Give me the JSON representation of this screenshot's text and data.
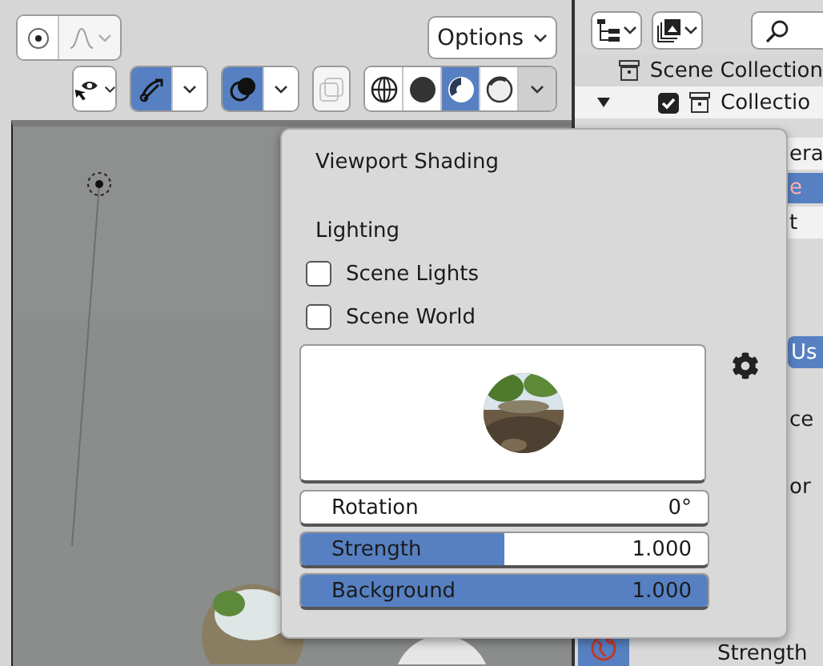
{
  "viewport_header": {
    "snap_toggles": [
      {
        "kind": "pivot",
        "disabled": false
      },
      {
        "kind": "falloff",
        "disabled": true
      }
    ],
    "options": {
      "label": "Options"
    },
    "toggles": [
      {
        "kind": "visibility",
        "selected": false,
        "disabled": false
      },
      {
        "kind": "gizmo",
        "selected": true,
        "disabled": false
      },
      {
        "kind": "overlay",
        "selected": true,
        "disabled": false
      },
      {
        "kind": "xray",
        "selected": false,
        "disabled": true
      }
    ],
    "shading_modes": [
      {
        "kind": "wireframe",
        "selected": false
      },
      {
        "kind": "solid",
        "selected": false
      },
      {
        "kind": "material",
        "selected": true
      },
      {
        "kind": "rendered",
        "selected": false
      }
    ]
  },
  "outliner": {
    "items": [
      {
        "label": "Scene Collection",
        "kind": "scene",
        "selected": false
      },
      {
        "label": "Collectio",
        "kind": "collection",
        "selected": false,
        "checked": true,
        "expanded": true
      },
      {
        "label": "era",
        "kind": "object",
        "selected": false
      },
      {
        "label": "e",
        "kind": "object",
        "selected": true
      },
      {
        "label": "t",
        "kind": "object",
        "selected": false
      }
    ]
  },
  "properties": {
    "use_button": {
      "label": "Us",
      "selected": true
    },
    "labels": [
      "ce",
      "or"
    ],
    "tabs": [
      {
        "kind": "world",
        "selected": true
      }
    ],
    "strength_label": "Strength"
  },
  "popup": {
    "title": "Viewport Shading",
    "section": "Lighting",
    "checkboxes": [
      {
        "label": "Scene Lights",
        "checked": false
      },
      {
        "label": "Scene World",
        "checked": false
      }
    ],
    "fields": [
      {
        "kind": "number",
        "label": "Rotation",
        "value": "0°"
      },
      {
        "kind": "slider",
        "label": "Strength",
        "value": "1.000",
        "level": 0.5
      },
      {
        "kind": "slider",
        "label": "Background",
        "value": "1.000",
        "level": 1
      }
    ]
  }
}
